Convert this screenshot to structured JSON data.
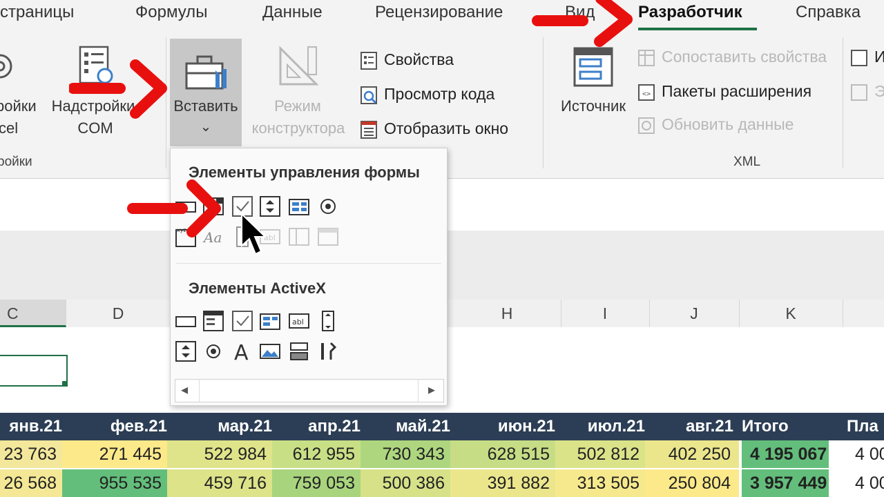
{
  "tabs": [
    {
      "label": "страницы"
    },
    {
      "label": "Формулы"
    },
    {
      "label": "Данные"
    },
    {
      "label": "Рецензирование"
    },
    {
      "label": "Вид"
    },
    {
      "label": "Разработчик"
    },
    {
      "label": "Справка"
    }
  ],
  "ribbon": {
    "addins_label_1": "ройки",
    "addins_label_2": "cel",
    "com_label_1": "Надстройки",
    "com_label_2": "COM",
    "group_addins": "ройки",
    "insert_label": "Вставить",
    "insert_chevron": "⌄",
    "design_mode_1": "Режим",
    "design_mode_2": "конструктора",
    "properties": "Свойства",
    "view_code": "Просмотр кода",
    "show_window": "Отобразить окно",
    "source": "Источник",
    "map_properties": "Сопоставить свойства",
    "expansion_packs": "Пакеты расширения",
    "refresh_data": "Обновить данные",
    "group_xml": "XML",
    "import_trunc": "И",
    "export_trunc": "Э"
  },
  "dropdown": {
    "form_controls_header": "Элементы управления формы",
    "activex_header": "Элементы ActiveX",
    "scroll_left": "◂",
    "scroll_right": "▸"
  },
  "columns": [
    "C",
    "D",
    "H",
    "I",
    "J",
    "K"
  ],
  "table": {
    "headers": [
      "янв.21",
      "фев.21",
      "мар.21",
      "апр.21",
      "май.21",
      "июн.21",
      "июл.21",
      "авг.21",
      "Итого",
      "Пла"
    ],
    "rows": [
      [
        "23 763",
        "271 445",
        "522 984",
        "612 955",
        "730 343",
        "628 515",
        "502 812",
        "402 250",
        "4 195 067",
        "4 00"
      ],
      [
        "26 568",
        "955 535",
        "459 716",
        "759 053",
        "500 386",
        "391 882",
        "313 505",
        "250 804",
        "3 957 449",
        "4 00"
      ]
    ]
  },
  "colors": {
    "accent_green": "#1e7145",
    "header_navy": "#2c3e55",
    "arrow_red": "#e8100f"
  }
}
